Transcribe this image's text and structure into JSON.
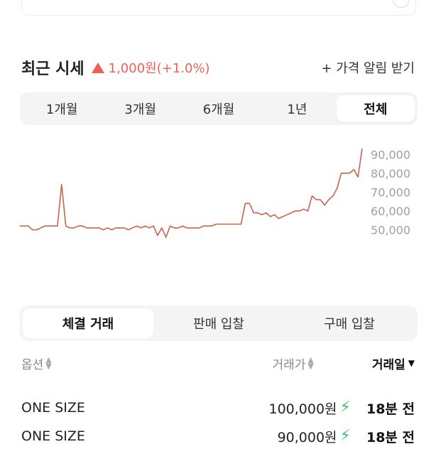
{
  "price_section": {
    "title": "최근 시세",
    "change_icon": "up-triangle-icon",
    "change_text": "1,000원(+1.0%)",
    "change_color": "#ef6253",
    "alarm_label": "+ 가격 알림 받기"
  },
  "period_tabs": [
    {
      "label": "1개월",
      "active": false
    },
    {
      "label": "3개월",
      "active": false
    },
    {
      "label": "6개월",
      "active": false
    },
    {
      "label": "1년",
      "active": false
    },
    {
      "label": "전체",
      "active": true
    }
  ],
  "chart_data": {
    "type": "line",
    "title": "",
    "xlabel": "",
    "ylabel": "",
    "ylim": [
      40000,
      95000
    ],
    "y_ticks": [
      "90,000",
      "80,000",
      "70,000",
      "60,000",
      "50,000"
    ],
    "grid": false,
    "line_color": "#c9634e",
    "values": [
      52000,
      52000,
      52000,
      50000,
      50000,
      51000,
      52000,
      52000,
      52000,
      52000,
      74000,
      52000,
      51000,
      51000,
      52000,
      52000,
      51000,
      51000,
      51000,
      51000,
      50000,
      51000,
      50000,
      51000,
      51000,
      51000,
      50000,
      51000,
      52000,
      51000,
      52000,
      51000,
      52000,
      47000,
      51000,
      46000,
      52000,
      51000,
      51000,
      52000,
      51000,
      51000,
      51000,
      51000,
      52000,
      52000,
      52000,
      53000,
      53000,
      53000,
      53000,
      53000,
      53000,
      53000,
      64000,
      64000,
      59000,
      59000,
      58000,
      59000,
      57000,
      58000,
      56000,
      57000,
      58000,
      59000,
      60000,
      60000,
      61000,
      60000,
      68000,
      66000,
      66000,
      63000,
      66000,
      68000,
      72000,
      80000,
      80000,
      80000,
      82000,
      78000,
      93000
    ]
  },
  "trade_tabs": [
    {
      "label": "체결 거래",
      "active": true
    },
    {
      "label": "판매 입찰",
      "active": false
    },
    {
      "label": "구매 입찰",
      "active": false
    }
  ],
  "columns": {
    "option": "옵션",
    "price": "거래가",
    "date": "거래일"
  },
  "rows": [
    {
      "option": "ONE SIZE",
      "price": "100,000원",
      "time": "18분 전"
    },
    {
      "option": "ONE SIZE",
      "price": "90,000원",
      "time": "18분 전"
    }
  ]
}
